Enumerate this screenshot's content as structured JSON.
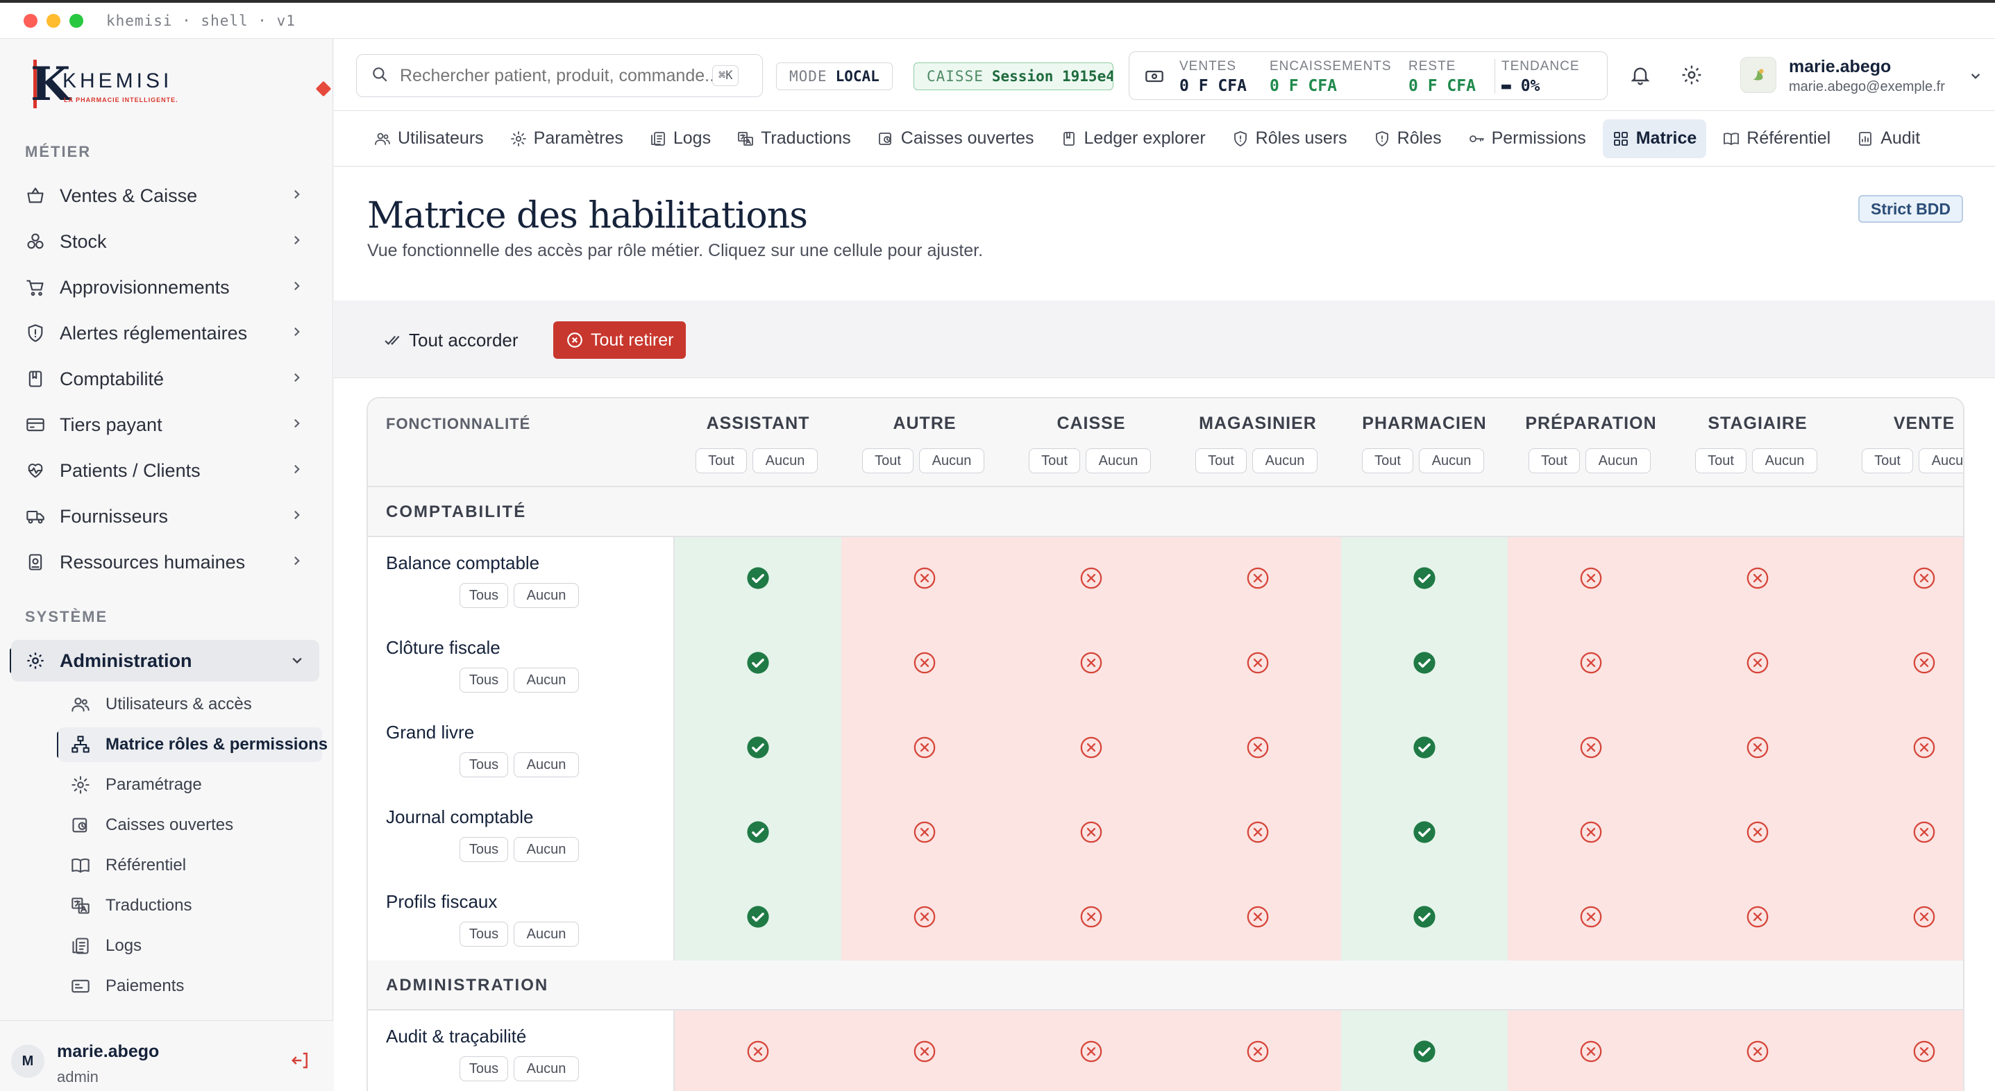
{
  "window": {
    "title": "khemisi · shell · v1"
  },
  "brand": {
    "word": "KHEMISI",
    "tagline": "LA PHARMACIE INTELLIGENTE."
  },
  "sidebar": {
    "section_metier": "MÉTIER",
    "section_systeme": "SYSTÈME",
    "items": [
      {
        "label": "Ventes & Caisse",
        "icon": "basket-icon"
      },
      {
        "label": "Stock",
        "icon": "boxes-icon"
      },
      {
        "label": "Approvisionnements",
        "icon": "cart-icon"
      },
      {
        "label": "Alertes réglementaires",
        "icon": "shield-alert-icon"
      },
      {
        "label": "Comptabilité",
        "icon": "ledger-icon"
      },
      {
        "label": "Tiers payant",
        "icon": "card-icon"
      },
      {
        "label": "Patients / Clients",
        "icon": "heart-pulse-icon"
      },
      {
        "label": "Fournisseurs",
        "icon": "truck-icon"
      },
      {
        "label": "Ressources humaines",
        "icon": "badge-icon"
      }
    ],
    "admin": {
      "label": "Administration",
      "icon": "gear-icon"
    },
    "subitems": [
      {
        "label": "Utilisateurs & accès",
        "icon": "users-icon"
      },
      {
        "label": "Matrice rôles & permissions",
        "icon": "hierarchy-icon"
      },
      {
        "label": "Paramétrage",
        "icon": "gear-icon"
      },
      {
        "label": "Caisses ouvertes",
        "icon": "register-icon"
      },
      {
        "label": "Référentiel",
        "icon": "book-icon"
      },
      {
        "label": "Traductions",
        "icon": "translate-icon"
      },
      {
        "label": "Logs",
        "icon": "logs-icon"
      },
      {
        "label": "Paiements",
        "icon": "payment-icon"
      }
    ],
    "footer": {
      "initial": "M",
      "name": "marie.abego",
      "role": "admin"
    }
  },
  "topbar": {
    "search_placeholder": "Rechercher patient, produit, commande...",
    "search_shortcut": "⌘K",
    "mode": {
      "key": "MODE",
      "value": "LOCAL"
    },
    "caisse": {
      "key": "CAISSE",
      "value": "Session 1915e4"
    },
    "stats": [
      {
        "key": "VENTES",
        "value": "0 F CFA",
        "color": "#15223a"
      },
      {
        "key": "ENCAISSEMENTS",
        "value": "0 F CFA",
        "color": "#1f8a4c"
      },
      {
        "key": "RESTE",
        "value": "0 F CFA",
        "color": "#1f8a4c"
      },
      {
        "key": "TENDANCE",
        "value": "▬ 0%",
        "color": "#15223a"
      }
    ],
    "user": {
      "name": "marie.abego",
      "email": "marie.abego@exemple.fr"
    }
  },
  "tabs": [
    {
      "label": "Utilisateurs",
      "icon": "users-icon"
    },
    {
      "label": "Paramètres",
      "icon": "gear-icon"
    },
    {
      "label": "Logs",
      "icon": "logs-icon"
    },
    {
      "label": "Traductions",
      "icon": "translate-icon"
    },
    {
      "label": "Caisses ouvertes",
      "icon": "register-icon"
    },
    {
      "label": "Ledger explorer",
      "icon": "ledger-icon"
    },
    {
      "label": "Rôles users",
      "icon": "shield-icon"
    },
    {
      "label": "Rôles",
      "icon": "shield-icon"
    },
    {
      "label": "Permissions",
      "icon": "key-icon"
    },
    {
      "label": "Matrice",
      "icon": "grid-icon",
      "active": true
    },
    {
      "label": "Référentiel",
      "icon": "book-icon"
    },
    {
      "label": "Audit",
      "icon": "audit-icon"
    }
  ],
  "page": {
    "title": "Matrice des habilitations",
    "subtitle": "Vue fonctionnelle des accès par rôle métier. Cliquez sur une cellule pour ajuster.",
    "badge": "Strict BDD",
    "grant_all": "Tout accorder",
    "revoke_all": "Tout retirer"
  },
  "matrix": {
    "feature_header": "FONCTIONNALITÉ",
    "role_all": "Tout",
    "role_none": "Aucun",
    "row_all": "Tous",
    "row_none": "Aucun",
    "roles": [
      "ASSISTANT",
      "AUTRE",
      "CAISSE",
      "MAGASINIER",
      "PHARMACIEN",
      "PRÉPARATION",
      "STAGIAIRE",
      "VENTE"
    ],
    "groups": [
      {
        "label": "COMPTABILITÉ",
        "rows": [
          {
            "name": "Balance comptable",
            "grants": [
              true,
              false,
              false,
              false,
              true,
              false,
              false,
              false
            ]
          },
          {
            "name": "Clôture fiscale",
            "grants": [
              true,
              false,
              false,
              false,
              true,
              false,
              false,
              false
            ]
          },
          {
            "name": "Grand livre",
            "grants": [
              true,
              false,
              false,
              false,
              true,
              false,
              false,
              false
            ]
          },
          {
            "name": "Journal comptable",
            "grants": [
              true,
              false,
              false,
              false,
              true,
              false,
              false,
              false
            ]
          },
          {
            "name": "Profils fiscaux",
            "grants": [
              true,
              false,
              false,
              false,
              true,
              false,
              false,
              false
            ]
          }
        ]
      },
      {
        "label": "ADMINISTRATION",
        "rows": [
          {
            "name": "Audit & traçabilité",
            "grants": [
              false,
              false,
              false,
              false,
              true,
              false,
              false,
              false
            ]
          }
        ]
      }
    ]
  },
  "colors": {
    "granted": "#1f7a45",
    "denied": "#d6453a",
    "brand": "#15223a",
    "danger": "#c8372d"
  }
}
